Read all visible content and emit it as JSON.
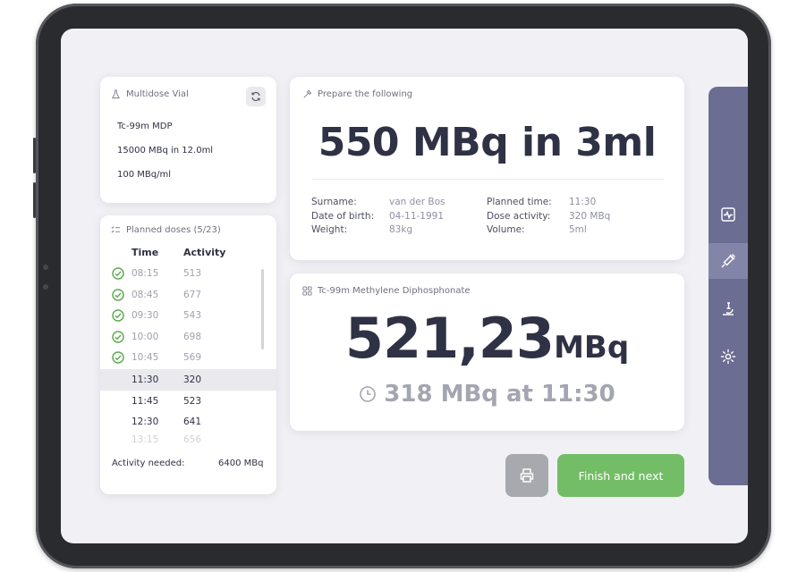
{
  "vial": {
    "header": "Multidose Vial",
    "product": "Tc-99m MDP",
    "total": "15000 MBq in 12.0ml",
    "concentration": "100 MBq/ml"
  },
  "doses": {
    "header": "Planned doses (5/23)",
    "col_time": "Time",
    "col_activity": "Activity",
    "rows": [
      {
        "time": "08:15",
        "activity": "513",
        "state": "done"
      },
      {
        "time": "08:45",
        "activity": "677",
        "state": "done"
      },
      {
        "time": "09:30",
        "activity": "543",
        "state": "done"
      },
      {
        "time": "10:00",
        "activity": "698",
        "state": "done"
      },
      {
        "time": "10:45",
        "activity": "569",
        "state": "done"
      },
      {
        "time": "11:30",
        "activity": "320",
        "state": "active"
      },
      {
        "time": "11:45",
        "activity": "523",
        "state": "future"
      },
      {
        "time": "12:30",
        "activity": "641",
        "state": "future"
      },
      {
        "time": "13:15",
        "activity": "656",
        "state": "faded"
      }
    ],
    "needed_label": "Activity needed:",
    "needed_value": "6400 MBq"
  },
  "prepare": {
    "header": "Prepare the following",
    "title": "550 MBq in 3ml",
    "surname_label": "Surname:",
    "surname": "van der Bos",
    "dob_label": "Date of birth:",
    "dob": "04-11-1991",
    "weight_label": "Weight:",
    "weight": "83kg",
    "planned_label": "Planned time:",
    "planned": "11:30",
    "dose_label": "Dose activity:",
    "dose": "320 MBq",
    "volume_label": "Volume:",
    "volume": "5ml"
  },
  "product": {
    "header": "Tc-99m Methylene Diphosphonate",
    "activity_value": "521,23",
    "activity_unit": "MBq",
    "projected": "318 MBq at 11:30"
  },
  "actions": {
    "finish_label": "Finish and next"
  },
  "rail": {
    "items": [
      {
        "icon": "activity-monitor-icon",
        "active": false
      },
      {
        "icon": "syringe-icon",
        "active": true
      },
      {
        "icon": "microscope-icon",
        "active": false
      },
      {
        "icon": "gear-icon",
        "active": false
      }
    ]
  },
  "colors": {
    "primary_text": "#2f3144",
    "rail": "#6b6d93",
    "finish": "#74bd67",
    "check": "#5aa84c"
  }
}
